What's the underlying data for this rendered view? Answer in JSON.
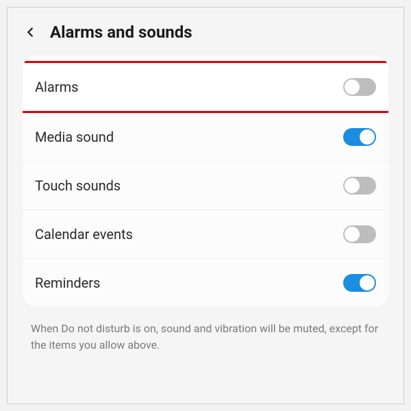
{
  "header": {
    "title": "Alarms and sounds"
  },
  "settings": [
    {
      "label": "Alarms",
      "enabled": false,
      "highlighted": true
    },
    {
      "label": "Media sound",
      "enabled": true,
      "highlighted": false
    },
    {
      "label": "Touch sounds",
      "enabled": false,
      "highlighted": false
    },
    {
      "label": "Calendar events",
      "enabled": false,
      "highlighted": false
    },
    {
      "label": "Reminders",
      "enabled": true,
      "highlighted": false
    }
  ],
  "footer": {
    "text": "When Do not disturb is on, sound and vibration will be muted, except for the items you allow above."
  }
}
